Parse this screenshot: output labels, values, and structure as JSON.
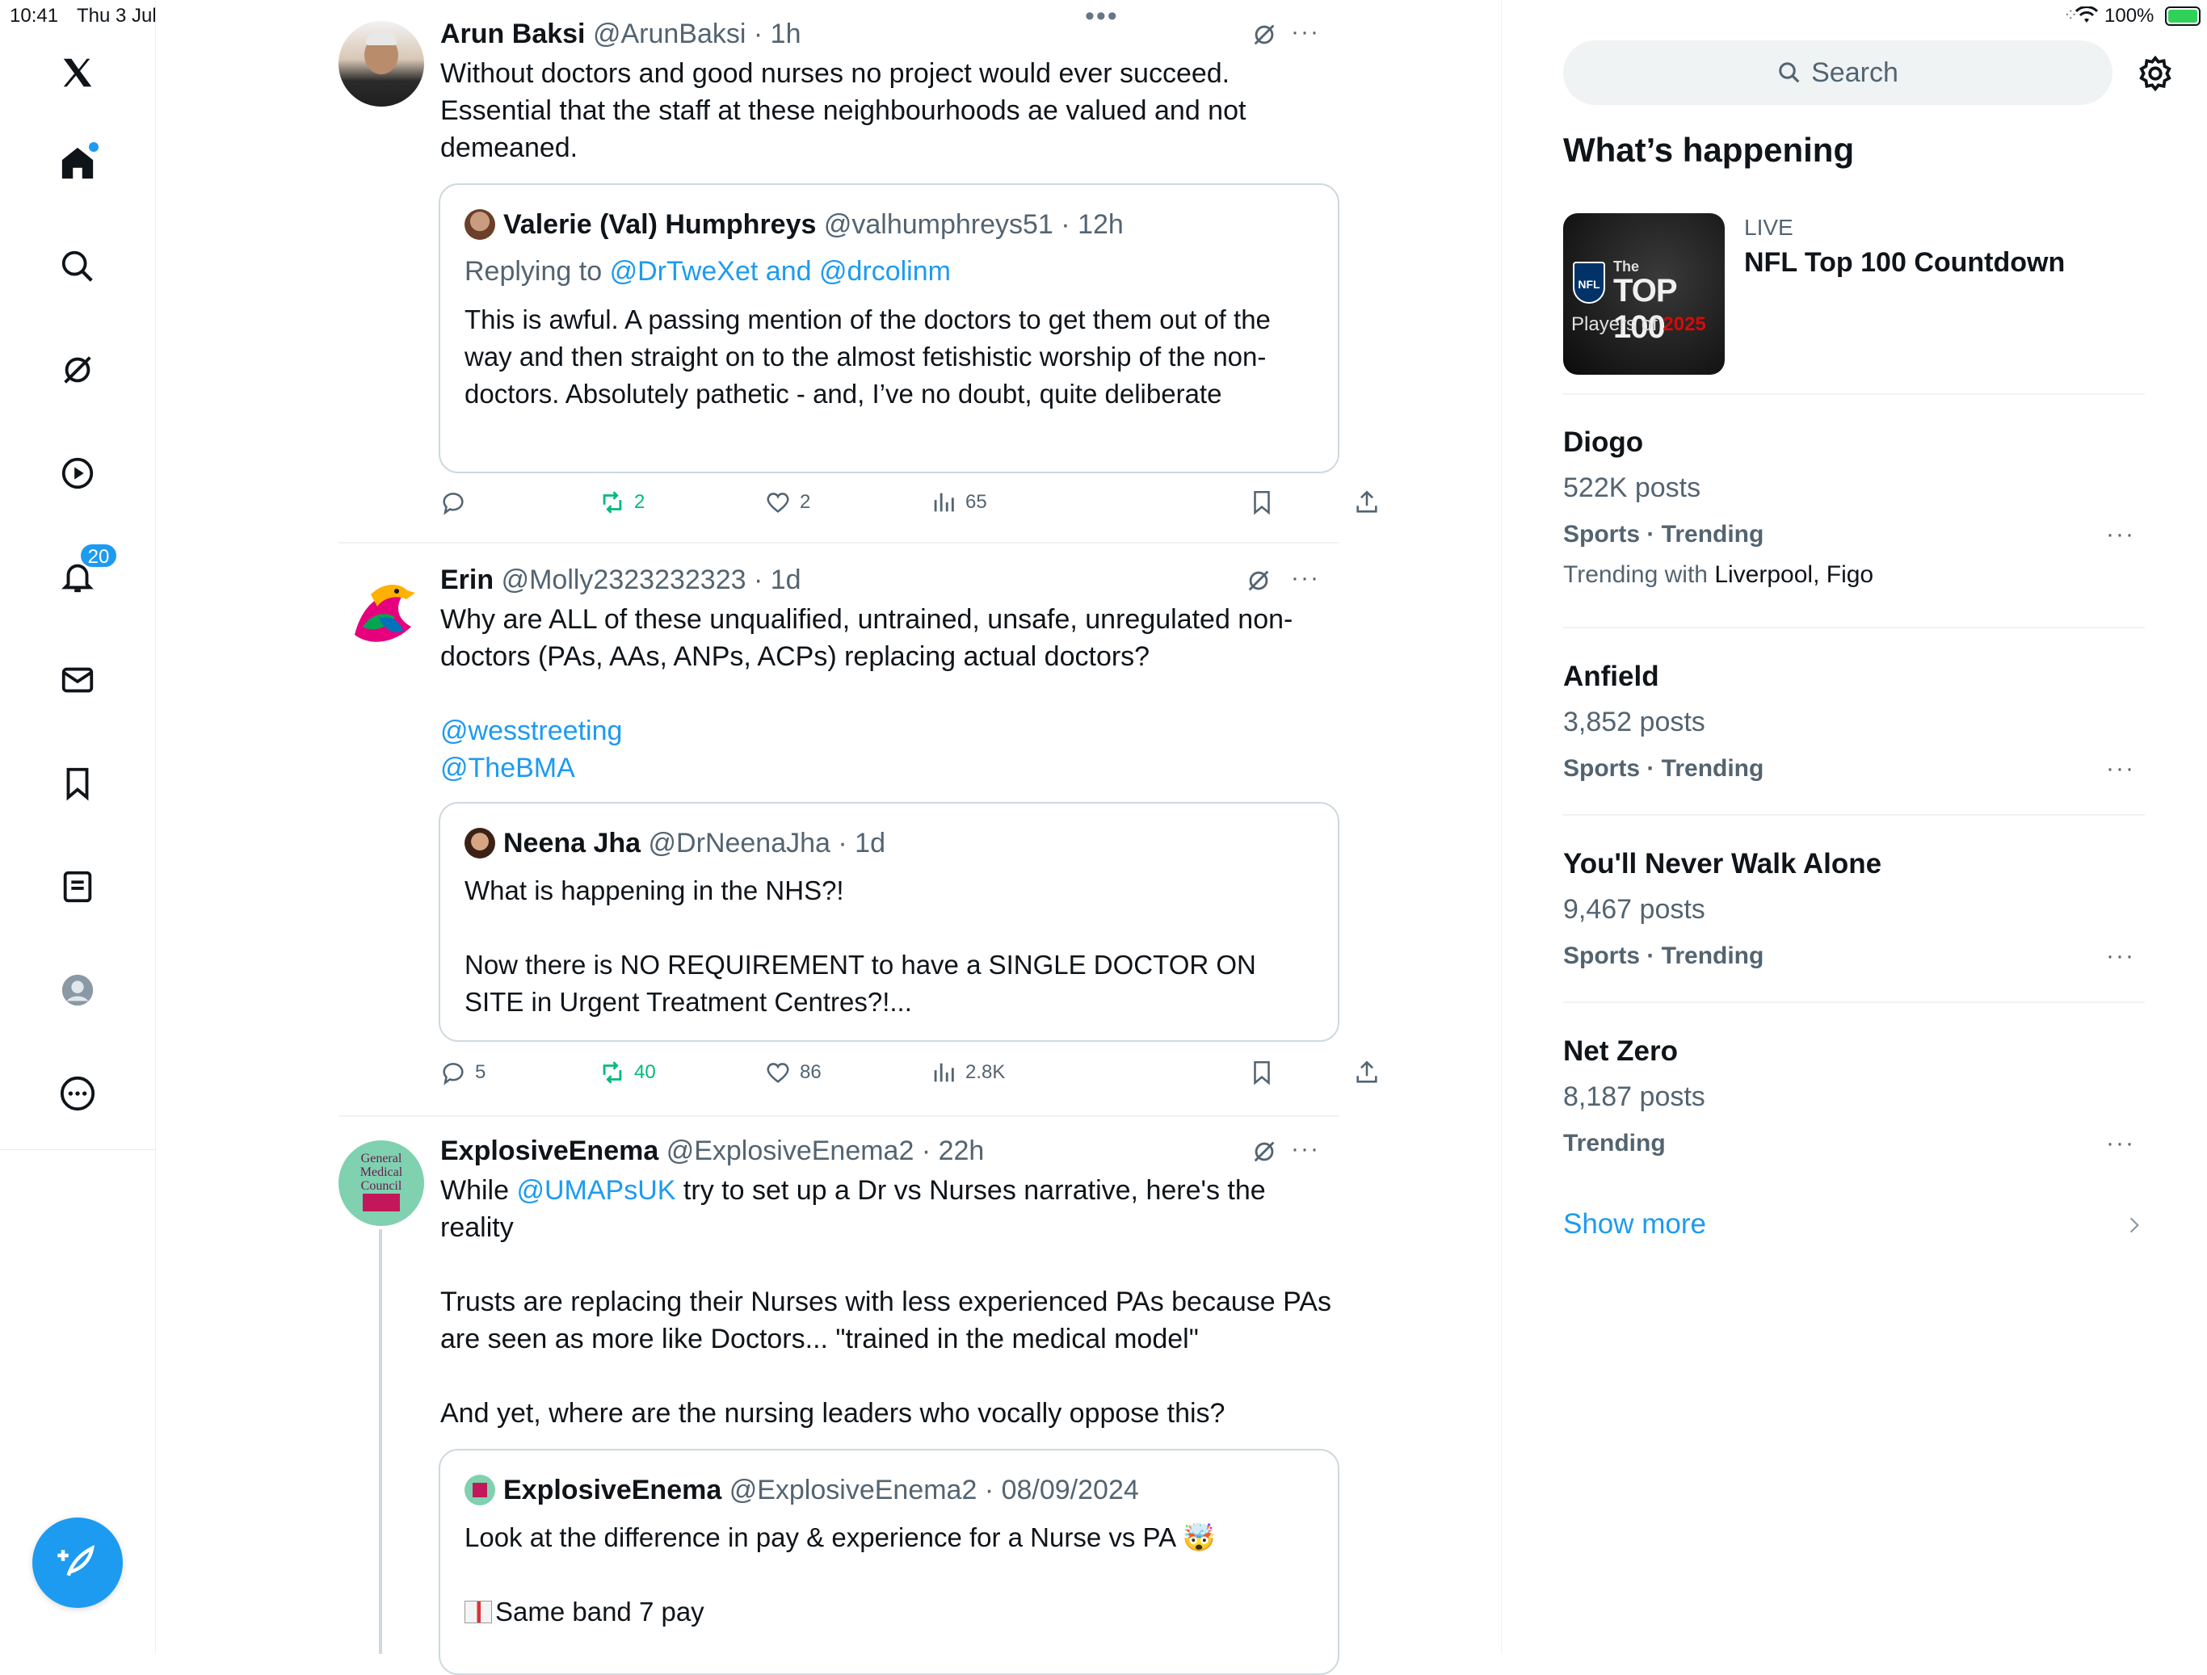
{
  "status_bar": {
    "time": "10:41",
    "date": "Thu 3 Jul",
    "battery": "100%"
  },
  "top_dots": "•••",
  "nav": {
    "notifications_count": "20"
  },
  "tweets": [
    {
      "name": "Arun Baksi",
      "handle": "@ArunBaksi",
      "time": "1h",
      "text": "Without doctors and good nurses no project would ever succeed. Essential that the staff at these neighbourhoods ae valued and not demeaned.",
      "quote": {
        "name": "Valerie (Val) Humphreys",
        "handle": "@valhumphreys51",
        "time": "12h",
        "replying_label": "Replying to",
        "replying_to": "@DrTweXet and @drcolinm",
        "text": "This is awful. A passing mention of the doctors to get them out of the way and then straight on to the almost fetishistic worship of the non-doctors. Absolutely pathetic - and, I’ve no doubt, quite deliberate"
      },
      "stats": {
        "replies": "",
        "reposts": "2",
        "likes": "2",
        "views": "65"
      }
    },
    {
      "name": "Erin",
      "handle": "@Molly2323232323",
      "time": "1d",
      "text": "Why are ALL of these unqualified, untrained, unsafe, unregulated non-doctors (PAs, AAs, ANPs, ACPs) replacing actual doctors?",
      "mention1": "@wesstreeting",
      "mention2": "@TheBMA",
      "quote": {
        "name": "Neena Jha",
        "handle": "@DrNeenaJha",
        "time": "1d",
        "text1": "What is happening in the NHS?!",
        "text2": "Now there is NO REQUIREMENT to have a SINGLE DOCTOR ON SITE in Urgent Treatment Centres?!..."
      },
      "stats": {
        "replies": "5",
        "reposts": "40",
        "likes": "86",
        "views": "2.8K"
      }
    },
    {
      "name": "ExplosiveEnema",
      "handle": "@ExplosiveEnema2",
      "time": "22h",
      "avatar_text": "General Medical Council",
      "text_pre": "While",
      "text_mention": "@UMAPsUK",
      "text_post": "try to set up a Dr vs Nurses narrative, here's the reality",
      "text2": "Trusts are replacing their Nurses with less experienced PAs because PAs are seen as more like Doctors... \"trained in the medical model\"",
      "text3": "And yet, where are the nursing leaders who vocally oppose this?",
      "quote": {
        "name": "ExplosiveEnema",
        "handle": "@ExplosiveEnema2",
        "time": "08/09/2024",
        "text1": "Look at the difference in pay & experience for a Nurse vs PA 🤯",
        "text2": "Same band 7 pay"
      }
    }
  ],
  "sidebar": {
    "search_placeholder": "Search",
    "section_title": "What’s happening",
    "live": {
      "label": "LIVE",
      "title": "NFL Top 100 Countdown",
      "image_text_the": "The",
      "image_text_top": "TOP 100",
      "image_text_players": "Players of",
      "image_text_year": "2025",
      "image_text_nfl": "NFL"
    },
    "trends": [
      {
        "title": "Diogo",
        "posts": "522K posts",
        "category": "Sports · Trending",
        "with_label": "Trending with",
        "with": "Liverpool, Figo"
      },
      {
        "title": "Anfield",
        "posts": "3,852 posts",
        "category": "Sports · Trending"
      },
      {
        "title": "You'll Never Walk Alone",
        "posts": "9,467 posts",
        "category": "Sports · Trending"
      },
      {
        "title": "Net Zero",
        "posts": "8,187 posts",
        "category": "Trending"
      }
    ],
    "show_more": "Show more"
  },
  "colors": {
    "accent": "#1d9bf0",
    "repost": "#00ba7c",
    "secondary_text": "#536471",
    "border": "#cfd9de"
  }
}
